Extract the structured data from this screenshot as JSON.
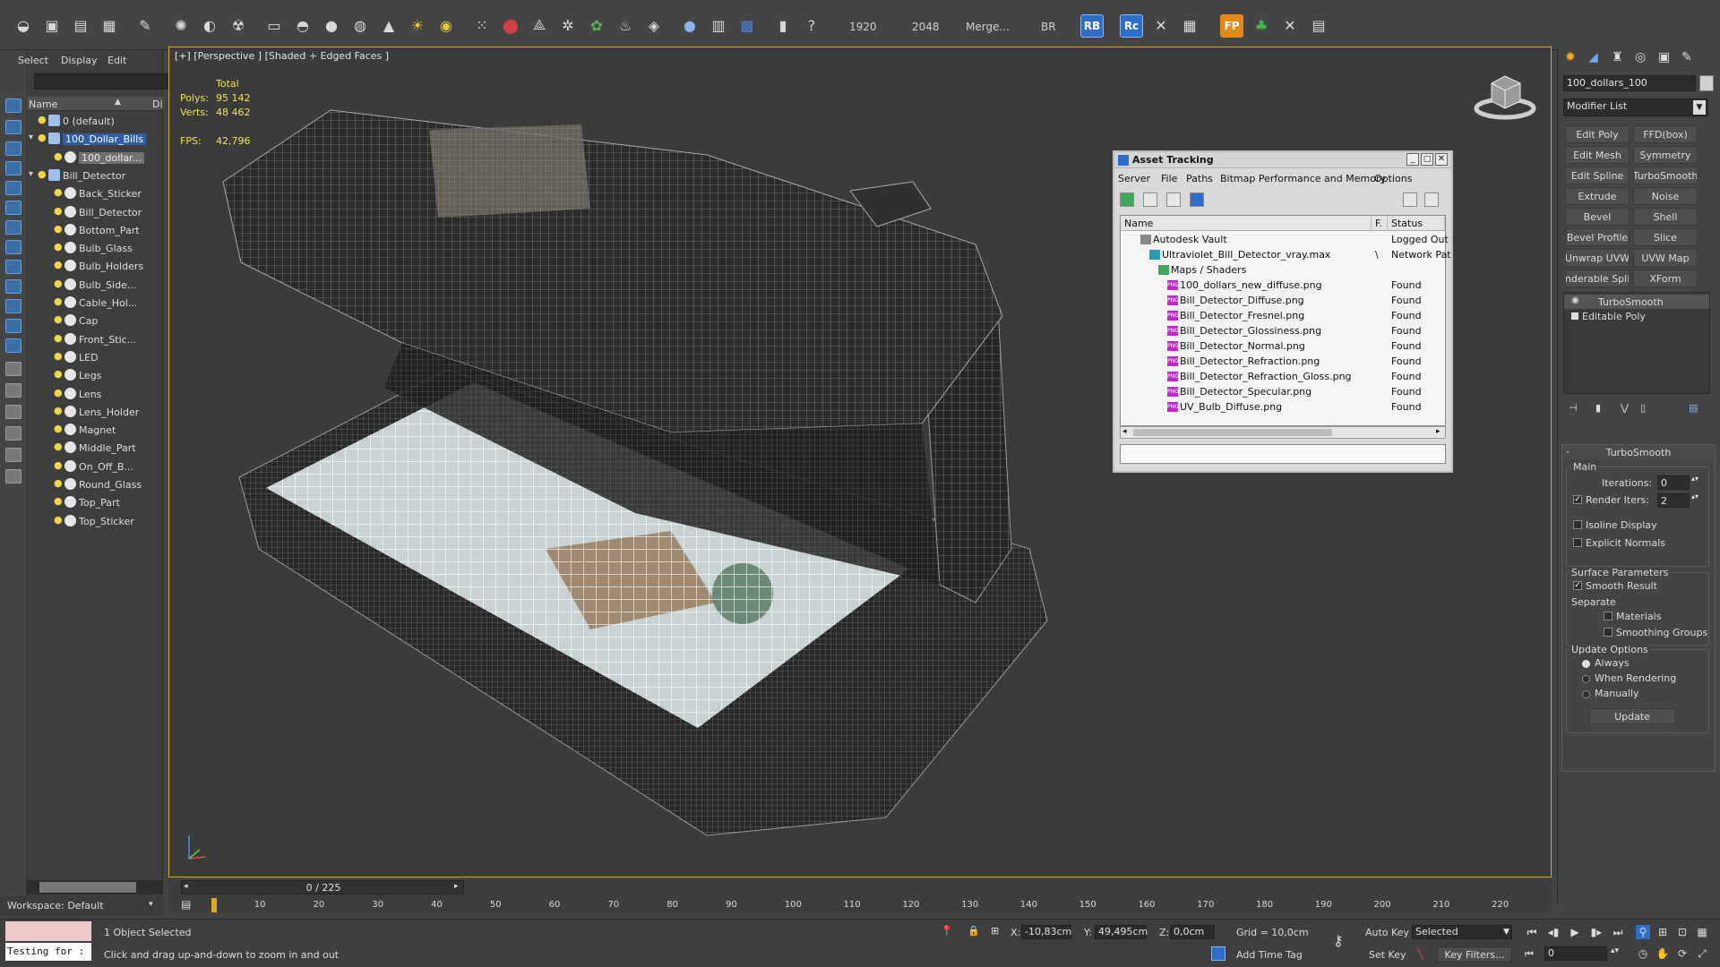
{
  "toolbar": {
    "render_width": "1920",
    "render_height": "2048",
    "merge_label": "Merge...",
    "br_label": "BR",
    "rb_badge": "RB",
    "rc_badge": "Rc",
    "fp_badge": "FP"
  },
  "explorer": {
    "menu": [
      "Select",
      "Display",
      "Edit"
    ],
    "header_name": "Name",
    "header_d": "Di",
    "items": [
      {
        "label": "0 (default)",
        "indent": 0,
        "expand": ""
      },
      {
        "label": "100_Dollar_Bills",
        "indent": 0,
        "expand": "▾",
        "state": "sel"
      },
      {
        "label": "100_dollar...",
        "indent": 1,
        "expand": "",
        "state": "sel2"
      },
      {
        "label": "Bill_Detector",
        "indent": 0,
        "expand": "▾"
      },
      {
        "label": "Back_Sticker",
        "indent": 1,
        "expand": ""
      },
      {
        "label": "Bill_Detector",
        "indent": 1,
        "expand": ""
      },
      {
        "label": "Bottom_Part",
        "indent": 1,
        "expand": ""
      },
      {
        "label": "Bulb_Glass",
        "indent": 1,
        "expand": ""
      },
      {
        "label": "Bulb_Holders",
        "indent": 1,
        "expand": ""
      },
      {
        "label": "Bulb_Side...",
        "indent": 1,
        "expand": ""
      },
      {
        "label": "Cable_Hol...",
        "indent": 1,
        "expand": ""
      },
      {
        "label": "Cap",
        "indent": 1,
        "expand": ""
      },
      {
        "label": "Front_Stic...",
        "indent": 1,
        "expand": ""
      },
      {
        "label": "LED",
        "indent": 1,
        "expand": ""
      },
      {
        "label": "Legs",
        "indent": 1,
        "expand": ""
      },
      {
        "label": "Lens",
        "indent": 1,
        "expand": ""
      },
      {
        "label": "Lens_Holder",
        "indent": 1,
        "expand": ""
      },
      {
        "label": "Magnet",
        "indent": 1,
        "expand": ""
      },
      {
        "label": "Middle_Part",
        "indent": 1,
        "expand": ""
      },
      {
        "label": "On_Off_B...",
        "indent": 1,
        "expand": ""
      },
      {
        "label": "Round_Glass",
        "indent": 1,
        "expand": ""
      },
      {
        "label": "Top_Part",
        "indent": 1,
        "expand": ""
      },
      {
        "label": "Top_Sticker",
        "indent": 1,
        "expand": ""
      }
    ],
    "workspace": "Workspace: Default"
  },
  "viewport": {
    "label": "[+] [Perspective ] [Shaded + Edged Faces ]",
    "stats": {
      "total_label": "Total",
      "polys_label": "Polys:",
      "polys_value": "95 142",
      "verts_label": "Verts:",
      "verts_value": "48 462",
      "fps_label": "FPS:",
      "fps_value": "42,796"
    }
  },
  "asset": {
    "title": "Asset Tracking",
    "menu": [
      "Server",
      "File",
      "Paths",
      "Bitmap Performance and Memory",
      "Options"
    ],
    "col_name": "Name",
    "col_f": "F.",
    "col_status": "Status",
    "rows": [
      {
        "name": "Autodesk Vault",
        "f": "",
        "status": "Logged Out",
        "indent": 1,
        "icon": "vault"
      },
      {
        "name": "Ultraviolet_Bill_Detector_vray.max",
        "f": "\\",
        "status": "Network Pat",
        "indent": 2,
        "icon": "max"
      },
      {
        "name": "Maps / Shaders",
        "f": "",
        "status": "",
        "indent": 3,
        "icon": "maps"
      },
      {
        "name": "100_dollars_new_diffuse.png",
        "f": "",
        "status": "Found",
        "indent": 4,
        "icon": "png"
      },
      {
        "name": "Bill_Detector_Diffuse.png",
        "f": "",
        "status": "Found",
        "indent": 4,
        "icon": "png"
      },
      {
        "name": "Bill_Detector_Fresnel.png",
        "f": "",
        "status": "Found",
        "indent": 4,
        "icon": "png"
      },
      {
        "name": "Bill_Detector_Glossiness.png",
        "f": "",
        "status": "Found",
        "indent": 4,
        "icon": "png"
      },
      {
        "name": "Bill_Detector_Normal.png",
        "f": "",
        "status": "Found",
        "indent": 4,
        "icon": "png"
      },
      {
        "name": "Bill_Detector_Refraction.png",
        "f": "",
        "status": "Found",
        "indent": 4,
        "icon": "png"
      },
      {
        "name": "Bill_Detector_Refraction_Gloss.png",
        "f": "",
        "status": "Found",
        "indent": 4,
        "icon": "png"
      },
      {
        "name": "Bill_Detector_Specular.png",
        "f": "",
        "status": "Found",
        "indent": 4,
        "icon": "png"
      },
      {
        "name": "UV_Bulb_Diffuse.png",
        "f": "",
        "status": "Found",
        "indent": 4,
        "icon": "png"
      }
    ]
  },
  "cmdpanel": {
    "object_name": "100_dollars_100",
    "modifier_list": "Modifier List",
    "modifier_buttons": [
      [
        "Edit Poly",
        "FFD(box)"
      ],
      [
        "Edit Mesh",
        "Symmetry"
      ],
      [
        "Edit Spline",
        "TurboSmooth"
      ],
      [
        "Extrude",
        "Noise"
      ],
      [
        "Bevel",
        "Shell"
      ],
      [
        "Bevel Profile",
        "Slice"
      ],
      [
        "Unwrap UVW",
        "UVW Map"
      ],
      [
        "Renderable Spline",
        "XForm"
      ]
    ],
    "stack": [
      "TurboSmooth",
      "Editable Poly"
    ],
    "rollout_title": "TurboSmooth",
    "main_label": "Main",
    "iterations_label": "Iterations:",
    "iterations_value": "0",
    "render_iters_label": "Render Iters:",
    "render_iters_value": "2",
    "isoline_label": "Isoline Display",
    "explicit_normals_label": "Explicit Normals",
    "surface_label": "Surface Parameters",
    "smooth_result_label": "Smooth Result",
    "separate_label": "Separate",
    "materials_label": "Materials",
    "smoothing_groups_label": "Smoothing Groups",
    "update_options_label": "Update Options",
    "always_label": "Always",
    "when_rendering_label": "When Rendering",
    "manually_label": "Manually",
    "update_button": "Update"
  },
  "timeline": {
    "frame_display": "0 / 225",
    "ticks": [
      "10",
      "20",
      "30",
      "40",
      "50",
      "60",
      "70",
      "80",
      "90",
      "100",
      "110",
      "120",
      "130",
      "140",
      "150",
      "160",
      "170",
      "180",
      "190",
      "200",
      "210",
      "220"
    ]
  },
  "statusbar": {
    "maxscript_text": "Testing for :",
    "selection_text": "1 Object Selected",
    "prompt_text": "Click and drag up-and-down to zoom in and out",
    "x_label": "X:",
    "x_value": "-10,83cm",
    "y_label": "Y:",
    "y_value": "49,495cm",
    "z_label": "Z:",
    "z_value": "0,0cm",
    "grid_text": "Grid = 10,0cm",
    "add_time_tag": "Add Time Tag",
    "auto_key": "Auto Key",
    "selected_value": "Selected",
    "set_key": "Set Key",
    "key_filters": "Key Filters...",
    "frame_value": "0"
  },
  "colors": {
    "viewport_border": "#d8a820",
    "selection_blue": "#2f5ea2",
    "png_icon": "#c026c9",
    "stats_yellow": "#f3e24e"
  }
}
